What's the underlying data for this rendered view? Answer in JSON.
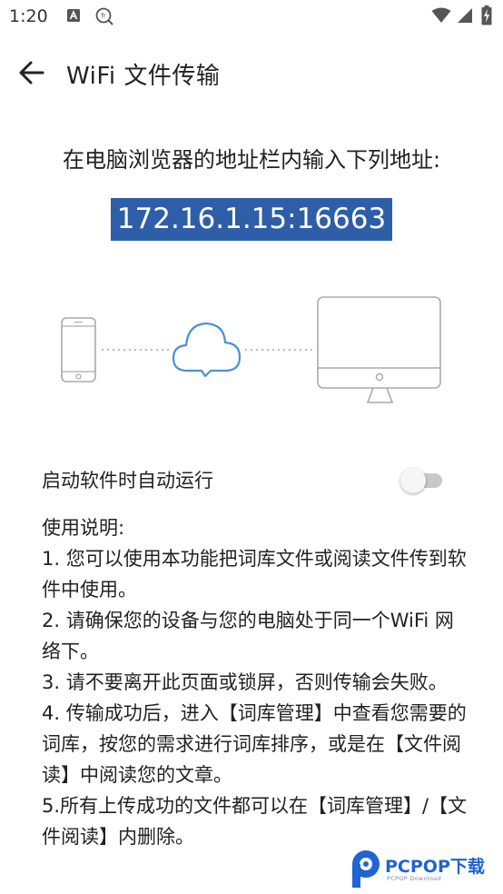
{
  "status_bar": {
    "time": "1:20",
    "left_icons": [
      "a-notification-icon",
      "translate-notification-icon"
    ],
    "right_icons": [
      "wifi-icon",
      "signal-icon",
      "battery-charging-icon"
    ]
  },
  "app_bar": {
    "back_icon": "arrow-left-icon",
    "title": "WiFi 文件传输"
  },
  "instruction": "在电脑浏览器的地址栏内输入下列地址:",
  "address": "172.16.1.15:16663",
  "address_highlight_color": "#2f5ea8",
  "illustration": {
    "icons": [
      "phone-icon",
      "cloud-icon",
      "monitor-icon"
    ],
    "cloud_color": "#4a90d9"
  },
  "auto_start": {
    "label": "启动软件时自动运行",
    "enabled": false
  },
  "usage": {
    "heading": "使用说明:",
    "items": [
      "1. 您可以使用本功能把词库文件或阅读文件传到软件中使用。",
      "2. 请确保您的设备与您的电脑处于同一个WiFi 网络下。",
      "3. 请不要离开此页面或锁屏，否则传输会失败。",
      "4. 传输成功后，进入【词库管理】中查看您需要的词库，按您的需求进行词库排序，或是在【文件阅读】中阅读您的文章。",
      "5.所有上传成功的文件都可以在【词库管理】/【文件阅读】内删除。"
    ]
  },
  "watermark": {
    "text": "PCPOP下载",
    "subtext": "PCPOP Download",
    "color": "#1f64d0"
  }
}
